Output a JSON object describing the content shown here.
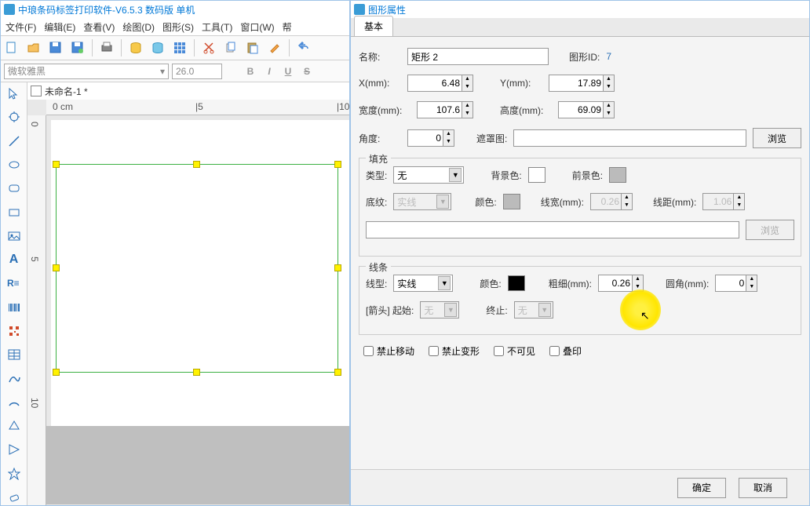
{
  "app": {
    "title": "中琅条码标签打印软件-V6.5.3 数码版 单机"
  },
  "menu": {
    "file": "文件(F)",
    "edit": "编辑(E)",
    "view": "查看(V)",
    "draw": "绘图(D)",
    "shape": "图形(S)",
    "tool": "工具(T)",
    "window": "窗口(W)",
    "help": "帮"
  },
  "fontbar": {
    "font_name": "微软雅黑",
    "font_size": "26.0",
    "bold": "B",
    "italic": "I",
    "underline": "U",
    "strike": "S"
  },
  "doc": {
    "tab_label": "未命名-1 *",
    "ruler_marks": {
      "m0": "0 cm",
      "m5": "|5",
      "m10": "|10"
    },
    "ruler_v": {
      "m0": "0",
      "m5": "5",
      "m10": "10"
    }
  },
  "dialog": {
    "title": "图形属性",
    "tab_basic": "基本",
    "labels": {
      "name": "名称:",
      "shape_id": "图形ID:",
      "x": "X(mm):",
      "y": "Y(mm):",
      "width": "宽度(mm):",
      "height": "高度(mm):",
      "angle": "角度:",
      "mask": "遮罩图:",
      "browse": "浏览",
      "fill": "填充",
      "fill_type": "类型:",
      "bgcolor": "背景色:",
      "fgcolor": "前景色:",
      "pattern": "底纹:",
      "color": "颜色:",
      "lw": "线宽(mm):",
      "ls": "线距(mm):",
      "stroke": "线条",
      "line_type": "线型:",
      "thickness": "粗细(mm):",
      "radius": "圆角(mm):",
      "arrow": "[箭头] 起始:",
      "arrow_end": "终止:",
      "lock_move": "禁止移动",
      "lock_resize": "禁止变形",
      "invisible": "不可见",
      "overprint": "叠印"
    },
    "values": {
      "name": "矩形 2",
      "shape_id": "7",
      "x": "6.48",
      "y": "17.89",
      "width": "107.6",
      "height": "69.09",
      "angle": "0",
      "mask": "",
      "fill_type": "无",
      "pattern": "实线",
      "lw": "0.26",
      "ls": "1.06",
      "line_type": "实线",
      "thickness": "0.26",
      "radius": "0",
      "arrow_start": "无",
      "arrow_end": "无"
    },
    "footer": {
      "ok": "确定",
      "cancel": "取消"
    }
  }
}
